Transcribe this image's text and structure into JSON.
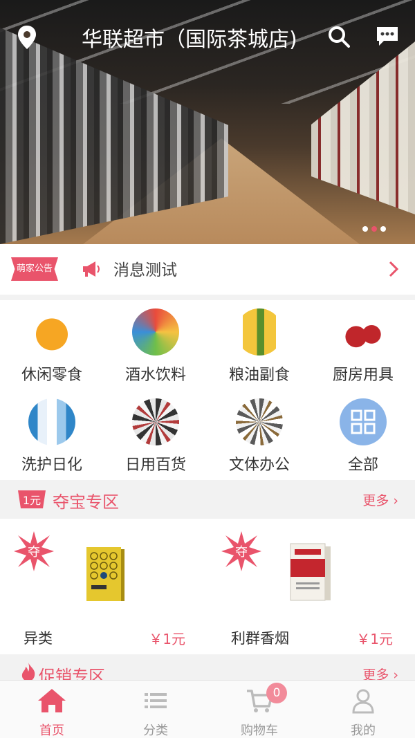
{
  "header": {
    "store_name": "华联超市（国际茶城店)",
    "carousel_count": 3,
    "carousel_active": 2
  },
  "notice": {
    "badge": "萌家公告",
    "text": "消息测试"
  },
  "categories": [
    {
      "label": "休闲零食",
      "icon": "snack-image"
    },
    {
      "label": "酒水饮料",
      "icon": "drinks-image"
    },
    {
      "label": "粮油副食",
      "icon": "grain-oil-image"
    },
    {
      "label": "厨房用具",
      "icon": "cookware-image"
    },
    {
      "label": "洗护日化",
      "icon": "toiletries-image"
    },
    {
      "label": "日用百货",
      "icon": "daily-goods-image"
    },
    {
      "label": "文体办公",
      "icon": "office-image"
    },
    {
      "label": "全部",
      "icon": "grid-icon"
    }
  ],
  "treasure": {
    "badge": "1元",
    "title": "夺宝专区",
    "more": "更多",
    "products": [
      {
        "name": "异类",
        "price": "￥1元",
        "star": "夺"
      },
      {
        "name": "利群香烟",
        "price": "￥1元",
        "star": "夺"
      }
    ]
  },
  "promo": {
    "title": "促销专区",
    "more": "更多"
  },
  "tabs": [
    {
      "label": "首页",
      "icon": "home-icon",
      "active": true
    },
    {
      "label": "分类",
      "icon": "list-icon",
      "active": false
    },
    {
      "label": "购物车",
      "icon": "cart-icon",
      "active": false,
      "badge": "0"
    },
    {
      "label": "我的",
      "icon": "user-icon",
      "active": false
    }
  ],
  "colors": {
    "accent": "#e9546b",
    "all_button": "#8ab4e8"
  }
}
